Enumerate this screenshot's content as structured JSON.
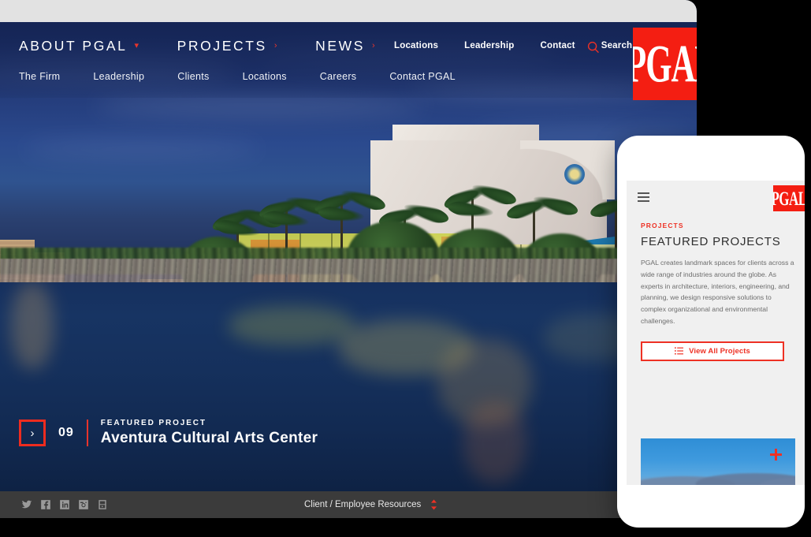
{
  "brand": {
    "name": "PGAL",
    "logo_text": "PGAL",
    "red": "#ee3124",
    "logo_red": "#f41e12",
    "navy": "#1b3168",
    "footer_gray": "#3b3b3b"
  },
  "desktop": {
    "primary_nav": [
      {
        "label": "ABOUT PGAL",
        "chevron": "chevron-down-icon",
        "glyph": "▾"
      },
      {
        "label": "PROJECTS",
        "chevron": "chevron-right-icon",
        "glyph": "›"
      },
      {
        "label": "NEWS",
        "chevron": "chevron-right-icon",
        "glyph": "›"
      }
    ],
    "sub_nav": [
      {
        "label": "The Firm"
      },
      {
        "label": "Leadership"
      },
      {
        "label": "Clients"
      },
      {
        "label": "Locations"
      },
      {
        "label": "Careers"
      },
      {
        "label": "Contact PGAL"
      }
    ],
    "utility_nav": [
      {
        "label": "Locations"
      },
      {
        "label": "Leadership"
      },
      {
        "label": "Contact"
      },
      {
        "label": "Search"
      }
    ],
    "search_icon": "search-icon",
    "hero": {
      "alt": "Aventura Cultural Arts Center at twilight reflected in water",
      "slide_number": "09",
      "eyebrow": "FEATURED PROJECT",
      "title": "Aventura Cultural Arts Center",
      "next_glyph": "›"
    },
    "footer": {
      "social": [
        {
          "name": "twitter-icon",
          "label": "Twitter"
        },
        {
          "name": "facebook-icon",
          "label": "Facebook"
        },
        {
          "name": "linkedin-icon",
          "label": "LinkedIn"
        },
        {
          "name": "instagram-icon",
          "label": "Instagram"
        },
        {
          "name": "youtube-icon",
          "label": "YouTube"
        }
      ],
      "resources_label": "Client / Employee Resources",
      "resources_toggle_icon": "chevron-up-down-icon"
    }
  },
  "mobile": {
    "menu_icon": "hamburger-menu-icon",
    "logo_text": "PGAL",
    "eyebrow": "PROJECTS",
    "heading": "FEATURED PROJECTS",
    "paragraph": "PGAL creates landmark spaces for clients across a wide range of industries around the globe. As experts in architecture, interiors, engineering, and planning, we design responsive solutions to complex organizational and environmental challenges.",
    "cta": {
      "label": "View All Projects",
      "icon": "list-icon"
    },
    "thumbnail": {
      "alt": "Aerial view of an airport terminal at dusk with mountains",
      "expand_icon": "plus-icon"
    }
  }
}
